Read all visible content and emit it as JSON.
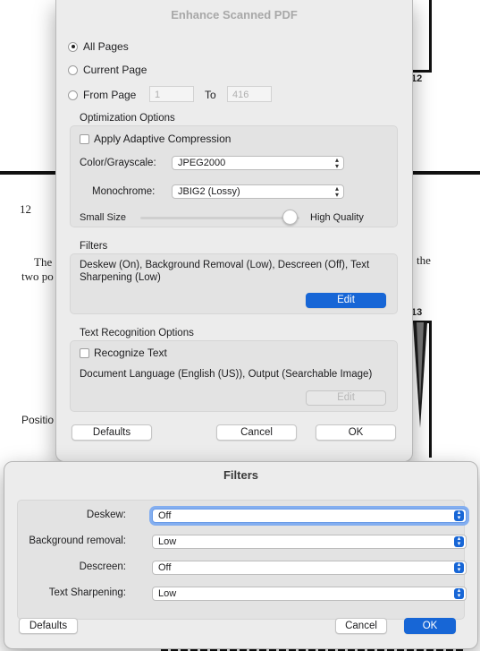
{
  "background_doc": {
    "page_num_left": "12",
    "page_num_right_top": "12",
    "page_num_right_mid": "13",
    "text_the_left": "The",
    "text_two": "two po",
    "text_the_right": "the",
    "text_position": "Positio"
  },
  "enhance_dialog": {
    "title": "Enhance Scanned PDF",
    "pages": {
      "all_pages": "All Pages",
      "current_page": "Current Page",
      "from_page": "From Page",
      "from_value": "1",
      "to_label": "To",
      "to_value": "416",
      "selected": "All Pages"
    },
    "optimization": {
      "section_label": "Optimization Options",
      "adaptive_compression_label": "Apply Adaptive Compression",
      "adaptive_compression_checked": false,
      "color_label": "Color/Grayscale:",
      "color_value": "JPEG2000",
      "mono_label": "Monochrome:",
      "mono_value": "JBIG2 (Lossy)",
      "small_size_label": "Small Size",
      "high_quality_label": "High Quality",
      "slider_value": 1.0
    },
    "filters": {
      "section_label": "Filters",
      "summary": "Deskew (On), Background Removal (Low), Descreen (Off), Text Sharpening (Low)",
      "edit_label": "Edit"
    },
    "text_recognition": {
      "section_label": "Text Recognition Options",
      "recognize_label": "Recognize Text",
      "recognize_checked": false,
      "summary": "Document Language (English (US)), Output (Searchable Image)",
      "edit_label": "Edit"
    },
    "buttons": {
      "defaults": "Defaults",
      "cancel": "Cancel",
      "ok": "OK"
    }
  },
  "filters_dialog": {
    "title": "Filters",
    "deskew_label": "Deskew:",
    "deskew_value": "Off",
    "bg_removal_label": "Background removal:",
    "bg_removal_value": "Low",
    "descreen_label": "Descreen:",
    "descreen_value": "Off",
    "sharpening_label": "Text Sharpening:",
    "sharpening_value": "Low",
    "buttons": {
      "defaults": "Defaults",
      "cancel": "Cancel",
      "ok": "OK"
    }
  },
  "colors": {
    "accent": "#1766d6",
    "dialog_bg": "#ececec",
    "group_bg": "#e3e3e3"
  }
}
